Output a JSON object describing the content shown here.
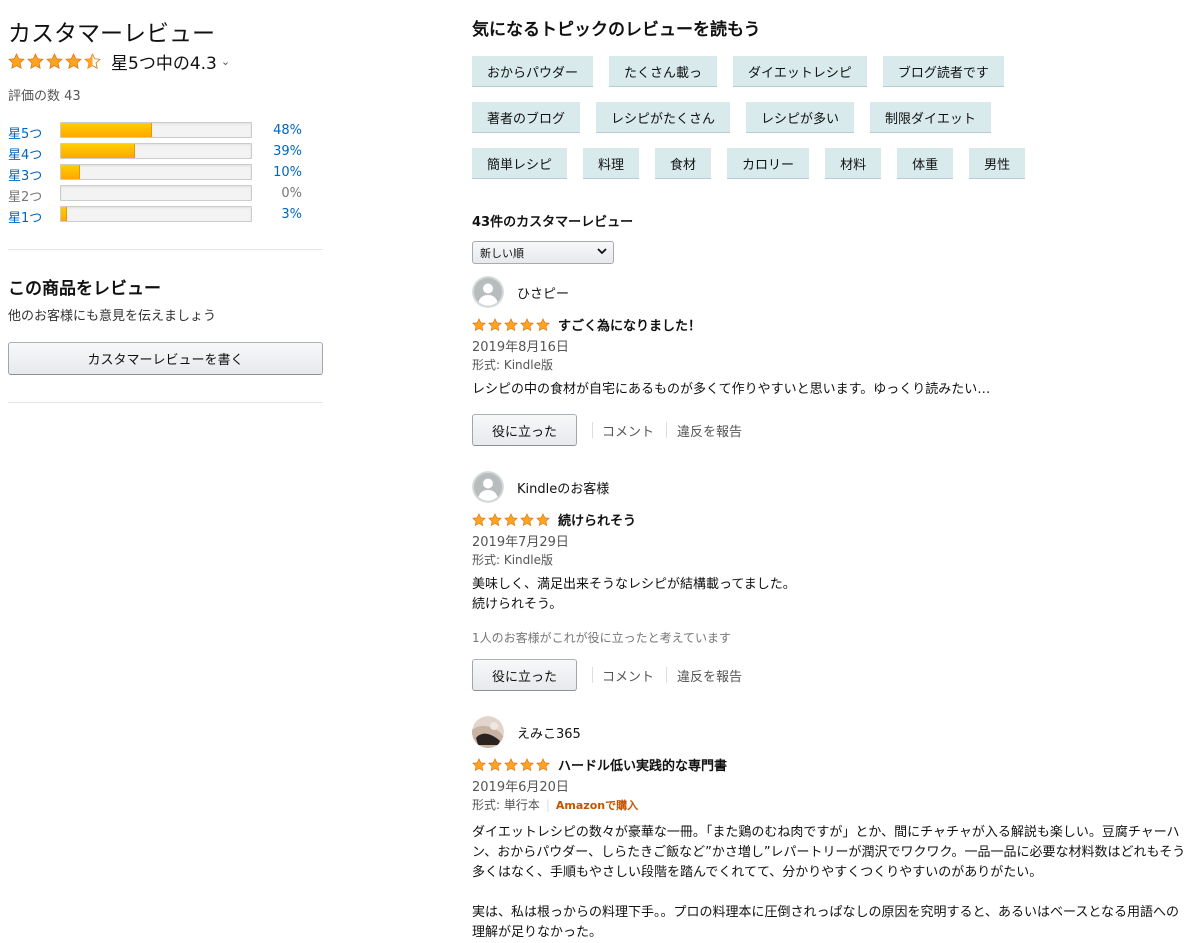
{
  "colors": {
    "star": "#ffa41c",
    "link": "#0066c0",
    "chip_bg": "#d9eaed",
    "bar_fill": "#ffa700",
    "amazon_purchase": "#c45500"
  },
  "summary": {
    "title": "カスタマーレビュー",
    "rating_value": 4.3,
    "rating_text": "星5つ中の4.3",
    "ratings_count_text": "評価の数 43",
    "histogram": [
      {
        "label": "星5つ",
        "percent": 48,
        "percent_text": "48%"
      },
      {
        "label": "星4つ",
        "percent": 39,
        "percent_text": "39%"
      },
      {
        "label": "星3つ",
        "percent": 10,
        "percent_text": "10%"
      },
      {
        "label": "星2つ",
        "percent": 0,
        "percent_text": "0%"
      },
      {
        "label": "星1つ",
        "percent": 3,
        "percent_text": "3%"
      }
    ]
  },
  "write_review": {
    "title": "この商品をレビュー",
    "subtitle": "他のお客様にも意見を伝えましょう",
    "button_label": "カスタマーレビューを書く"
  },
  "topics": {
    "title": "気になるトピックのレビューを読もう",
    "rows": [
      [
        "おからパウダー",
        "たくさん載っ",
        "ダイエットレシピ",
        "ブログ読者です"
      ],
      [
        "著者のブログ",
        "レシピがたくさん",
        "レシピが多い",
        "制限ダイエット"
      ],
      [
        "簡単レシピ",
        "料理",
        "食材",
        "カロリー",
        "材料",
        "体重",
        "男性"
      ]
    ]
  },
  "reviews_header": {
    "count_text": "43件のカスタマーレビュー",
    "sort_selected": "新しい順"
  },
  "reviews": [
    {
      "name": "ひさピー",
      "avatar_icon": "default-avatar-icon",
      "stars": 5,
      "title": "すごく為になりました！",
      "date": "2019年8月16日",
      "format": "形式: Kindle版",
      "body": "レシピの中の食材が自宅にあるものが多くて作りやすいと思います。ゆっくり読みたい…",
      "helped": "",
      "helpful_label": "役に立った",
      "comment_label": "コメント",
      "report_label": "違反を報告"
    },
    {
      "name": "Kindleのお客様",
      "avatar_icon": "default-avatar-icon",
      "stars": 5,
      "title": "続けられそう",
      "date": "2019年7月29日",
      "format": "形式: Kindle版",
      "body_lines": [
        "美味しく、満足出来そうなレシピが結構載ってました。",
        "続けられそう。"
      ],
      "helped": "1人のお客様がこれが役に立ったと考えています",
      "helpful_label": "役に立った",
      "comment_label": "コメント",
      "report_label": "違反を報告"
    },
    {
      "name": "えみこ365",
      "avatar_icon": "photo-avatar-icon",
      "stars": 5,
      "title": "ハードル低い実践的な専門書",
      "date": "2019年6月20日",
      "format": "形式: 単行本",
      "purchase_badge": "Amazonで購入",
      "body_p1": "ダイエットレシピの数々が豪華な一冊。「また鶏のむね肉ですが」とか、間にチャチャが入る解説も楽しい。豆腐チャーハン、おからパウダー、しらたきご飯など”かさ増し”レパートリーが潤沢でワクワク。一品一品に必要な材料数はどれもそう多くはなく、手順もやさしい段階を踏んでくれてて、分かりやすくつくりやすいのがありがたい。",
      "body_p2": "実は、私は根っからの料理下手。。プロの料理本に圧倒されっぱなしの原因を究明すると、あるいはベースとなる用語への理解が足りなかった。"
    }
  ]
}
